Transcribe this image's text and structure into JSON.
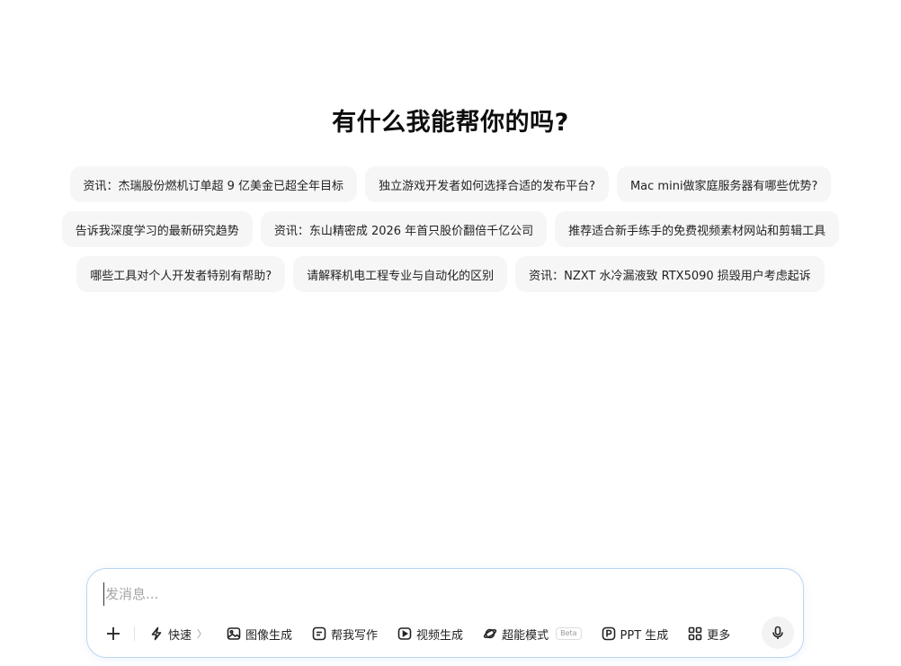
{
  "heading": "有什么我能帮你的吗?",
  "suggestions": {
    "row1": [
      "资讯：杰瑞股份燃机订单超 9 亿美金已超全年目标",
      "独立游戏开发者如何选择合适的发布平台?",
      "Mac mini做家庭服务器有哪些优势?"
    ],
    "row2": [
      "告诉我深度学习的最新研究趋势",
      "资讯：东山精密成 2026 年首只股价翻倍千亿公司",
      "推荐适合新手练手的免费视频素材网站和剪辑工具"
    ],
    "row3": [
      "哪些工具对个人开发者特别有帮助?",
      "请解释机电工程专业与自动化的区别",
      "资讯：NZXT 水冷漏液致 RTX5090 损毁用户考虑起诉"
    ]
  },
  "composer": {
    "placeholder": "发消息...",
    "tools": {
      "quick": "快速",
      "quick_chevron": "〉",
      "image": "图像生成",
      "write": "帮我写作",
      "video": "视频生成",
      "super": "超能模式",
      "super_badge": "Beta",
      "ppt": "PPT 生成",
      "more": "更多"
    }
  },
  "icons": {
    "plus": "plus-icon",
    "quick": "lightning-icon",
    "image": "image-icon",
    "write": "edit-icon",
    "video": "play-icon",
    "super": "planet-icon",
    "ppt": "ppt-icon",
    "more": "grid-icon",
    "mic": "microphone-icon"
  },
  "colors": {
    "chip_bg": "#f6f6f7",
    "composer_border": "#b9d6f2"
  }
}
